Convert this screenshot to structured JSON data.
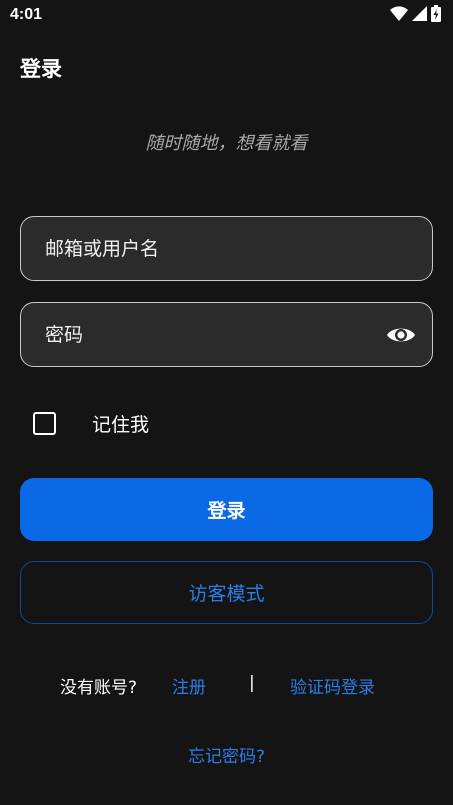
{
  "status_bar": {
    "time": "4:01",
    "icons": [
      "wifi-icon",
      "signal-icon",
      "battery-charging-icon"
    ]
  },
  "header": {
    "title": "登录",
    "slogan": "随时随地，想看就看"
  },
  "form": {
    "username_placeholder": "邮箱或用户名",
    "password_placeholder": "密码",
    "password_toggle_icon": "eye-icon",
    "remember_label": "记住我",
    "remember_checked": false,
    "login_button": "登录",
    "guest_button": "访客模式"
  },
  "footer": {
    "no_account": "没有账号?",
    "register": "注册",
    "divider": "|",
    "sms_login": "验证码登录",
    "forgot_password": "忘记密码?"
  },
  "colors": {
    "background": "#141414",
    "accent": "#0a6ae6",
    "link": "#2b7de8",
    "input_bg": "#2b2b2b"
  }
}
